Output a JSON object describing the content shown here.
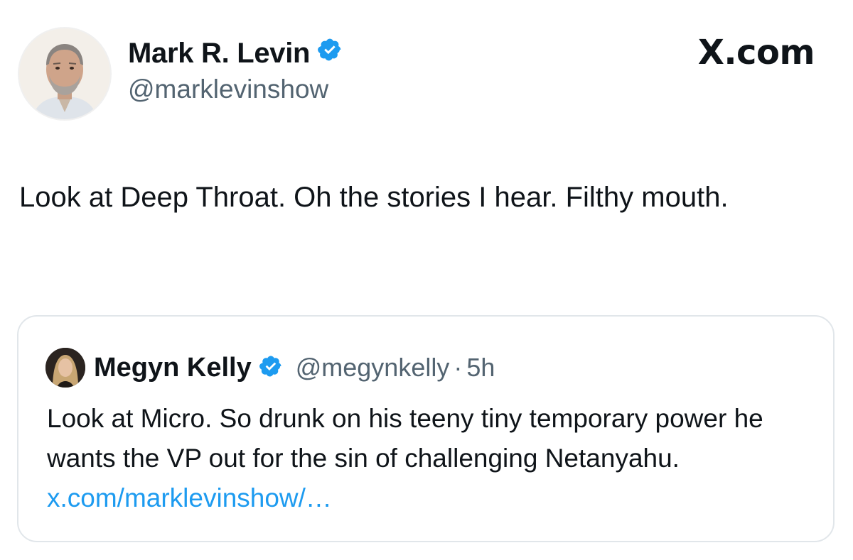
{
  "site": {
    "label": "X.com"
  },
  "post": {
    "author": {
      "name": "Mark R. Levin",
      "handle": "@marklevinshow",
      "avatar_icon": "profile-photo-man-icon",
      "verified_icon": "verified-badge-icon"
    },
    "text": "Look at Deep Throat. Oh the stories I hear.  Filthy mouth."
  },
  "quoted_post": {
    "author": {
      "name": "Megyn Kelly",
      "handle": "@megynkelly",
      "separator": "·",
      "time": "5h",
      "avatar_icon": "profile-photo-woman-icon",
      "verified_icon": "verified-badge-icon"
    },
    "text": "Look at Micro. So drunk on his teeny tiny temporary power he wants the VP out for the sin of challenging Netanyahu.",
    "link_text": "x.com/marklevinshow/…"
  },
  "colors": {
    "verified_blue": "#1d9bf0",
    "link_blue": "#1d9bf0",
    "secondary_text": "#536471",
    "primary_text": "#0f1419",
    "card_border": "#e1e6ea"
  }
}
